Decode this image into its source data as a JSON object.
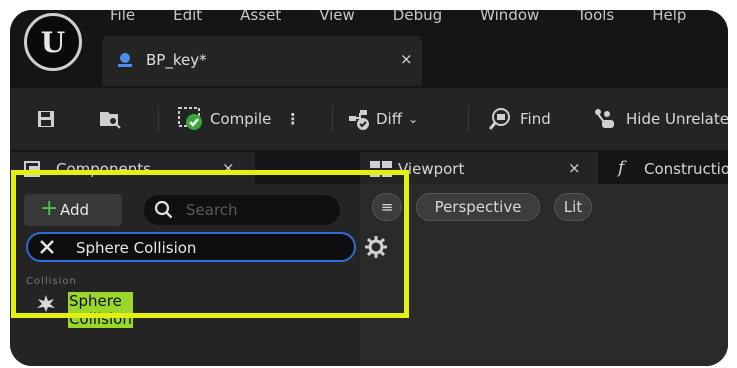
{
  "menu": [
    "File",
    "Edit",
    "Asset",
    "View",
    "Debug",
    "Window",
    "Tools",
    "Help"
  ],
  "document_tab": {
    "title": "BP_key*",
    "close": "×"
  },
  "toolbar": {
    "compile_label": "Compile",
    "diff_label": "Diff",
    "find_label": "Find",
    "hide_label": "Hide Unrelated"
  },
  "components_panel": {
    "tab_label": "Components",
    "close": "×",
    "add_label": "Add",
    "search_placeholder": "Search",
    "filter_value": "Sphere Collision",
    "category": "Collision",
    "result_label": "Sphere Collision"
  },
  "viewport_panel": {
    "tab_label": "Viewport",
    "close": "×",
    "construction_label": "Construction Script",
    "perspective_label": "Perspective",
    "lit_label": "Lit"
  },
  "colors": {
    "highlight": "#e3f012",
    "match": "#9bd62b",
    "accent_blue": "#2f6cd6",
    "add_green": "#4cc24c"
  }
}
